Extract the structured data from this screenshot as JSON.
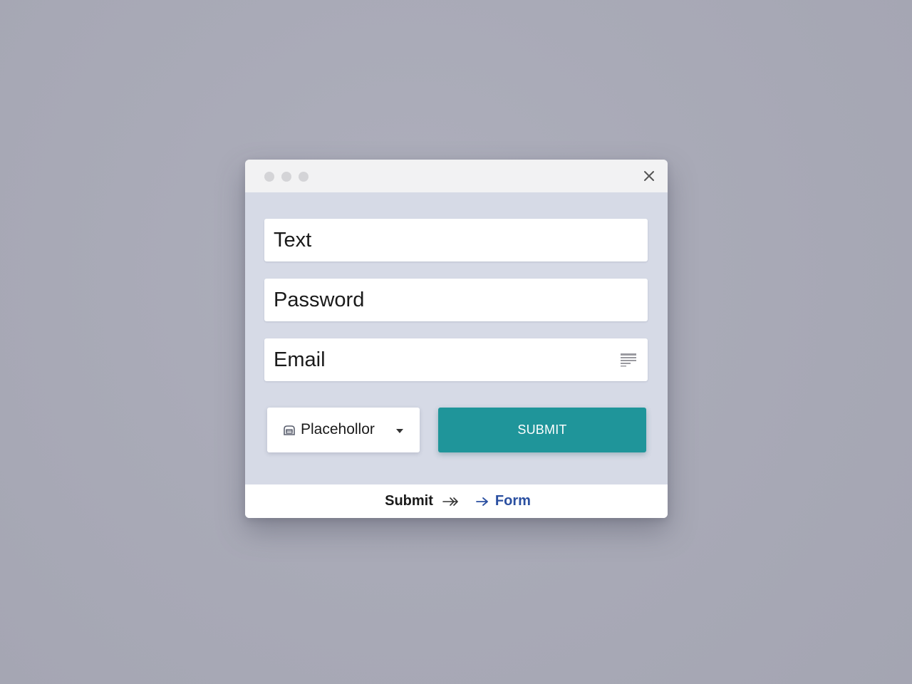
{
  "window": {
    "controls": [
      "window-dot",
      "window-dot",
      "window-dot"
    ],
    "close_icon": "close-icon"
  },
  "form": {
    "text_field": {
      "placeholder": "Text",
      "value": ""
    },
    "password_field": {
      "placeholder": "Password",
      "value": ""
    },
    "email_field": {
      "placeholder": "Email",
      "value": "",
      "icon": "list-icon"
    },
    "dropdown": {
      "selected": "Placehollor",
      "icon": "tray-icon",
      "caret": "chevron-down-icon"
    },
    "submit_label": "SUBMIT"
  },
  "footer": {
    "crumb_submit": "Submit",
    "crumb_form": "Form",
    "separator_icon": "double-arrow-icon",
    "arrow_icon": "arrow-right-icon"
  },
  "colors": {
    "accent": "#1f959a",
    "link": "#2a4fa0",
    "panel": "#d6dae6",
    "titlebar": "#f2f2f3",
    "background": "#a9aab7"
  }
}
